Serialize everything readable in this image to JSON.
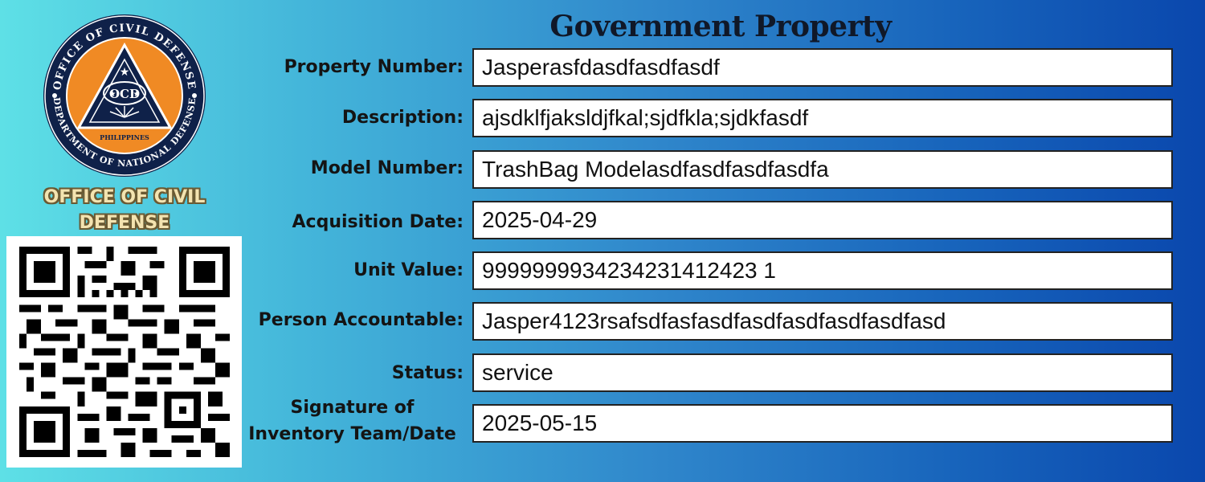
{
  "title": "Government Property",
  "logo": {
    "ring_text_top": "OFFICE OF CIVIL DEFENSE",
    "ring_text_bottom": "DEPARTMENT OF NATIONAL DEFENSE",
    "center_text": "OCD",
    "banner_text": "PHILIPPINES",
    "colors": {
      "ring": "#0f2149",
      "inner": "#f08a24",
      "triangle": "#0f2149"
    }
  },
  "organization": {
    "line1": "OFFICE OF CIVIL",
    "line2": "DEFENSE"
  },
  "qr_code": {
    "icon": "qr-code-icon"
  },
  "fields": [
    {
      "label": "Property Number:",
      "value": "Jasperasfdasdfasdfasdf"
    },
    {
      "label": "Description:",
      "value": "ajsdklfjaksldjfkal;sjdfkla;sjdkfasdf"
    },
    {
      "label": "Model Number:",
      "value": "TrashBag Modelasdfasdfasdfasdfa"
    },
    {
      "label": "Acquisition Date:",
      "value": "2025-04-29"
    },
    {
      "label": "Unit Value:",
      "value": "9999999934234231412423 1"
    },
    {
      "label": "Person Accountable:",
      "value": "Jasper4123rsafsdfasfasdfasdfasdfasdfasdfasd"
    },
    {
      "label": "Status:",
      "value": "service"
    },
    {
      "label": "Signature of Inventory Team/Date",
      "label_line1": "Signature of",
      "label_line2": "Inventory Team/Date",
      "value": "2025-05-15"
    }
  ]
}
